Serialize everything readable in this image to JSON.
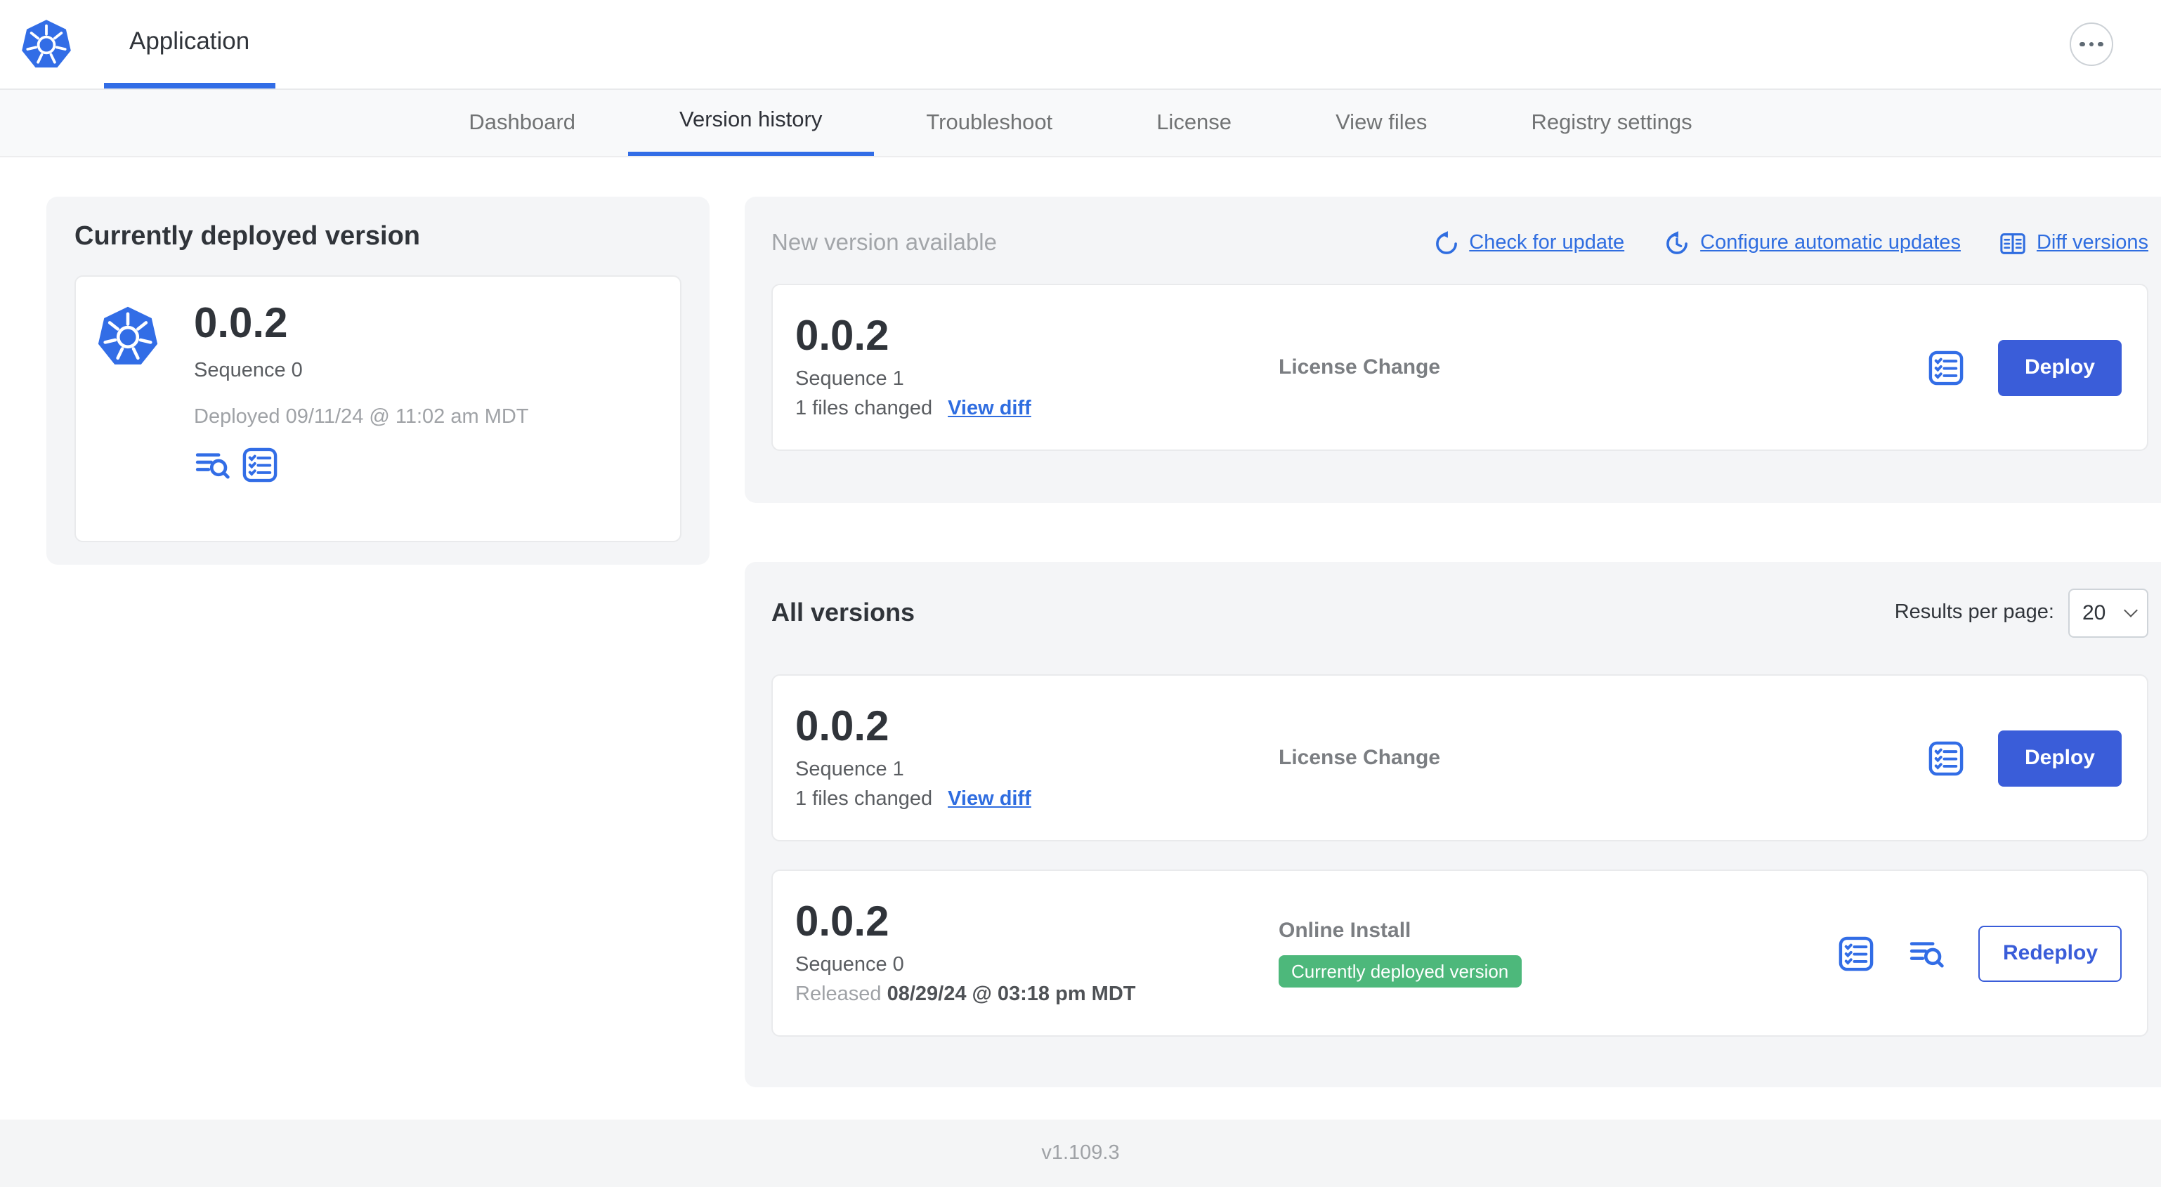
{
  "header": {
    "app_tab": "Application"
  },
  "nav": {
    "tabs": [
      {
        "label": "Dashboard"
      },
      {
        "label": "Version history"
      },
      {
        "label": "Troubleshoot"
      },
      {
        "label": "License"
      },
      {
        "label": "View files"
      },
      {
        "label": "Registry settings"
      }
    ],
    "active_tab": "Version history"
  },
  "current_version": {
    "title": "Currently deployed version",
    "version": "0.0.2",
    "sequence": "Sequence 0",
    "deployed": "Deployed 09/11/24 @ 11:02 am MDT"
  },
  "new_version": {
    "title": "New version available",
    "check_for_update": "Check for update",
    "configure_updates": "Configure automatic updates",
    "diff_versions": "Diff versions",
    "card": {
      "version": "0.0.2",
      "sequence": "Sequence 1",
      "files_changed": "1 files changed",
      "view_diff": "View diff",
      "change_type": "License Change",
      "deploy": "Deploy"
    }
  },
  "all_versions": {
    "title": "All versions",
    "results_label": "Results per page:",
    "results_value": "20",
    "rows": [
      {
        "version": "0.0.2",
        "sequence": "Sequence 1",
        "files_changed": "1 files changed",
        "view_diff": "View diff",
        "change_type": "License Change",
        "action": "Deploy"
      },
      {
        "version": "0.0.2",
        "sequence": "Sequence 0",
        "released_prefix": "Released",
        "released_date": "08/29/24 @ 03:18 pm MDT",
        "change_type": "Online Install",
        "badge": "Currently deployed version",
        "action": "Redeploy"
      }
    ]
  },
  "footer": {
    "app_version": "v1.109.3"
  },
  "colors": {
    "primary_blue": "#326de6",
    "button_blue": "#3a5dd9",
    "link_blue": "#2f6de0",
    "badge_green": "#4db87b",
    "panel_gray": "#f4f5f7"
  }
}
